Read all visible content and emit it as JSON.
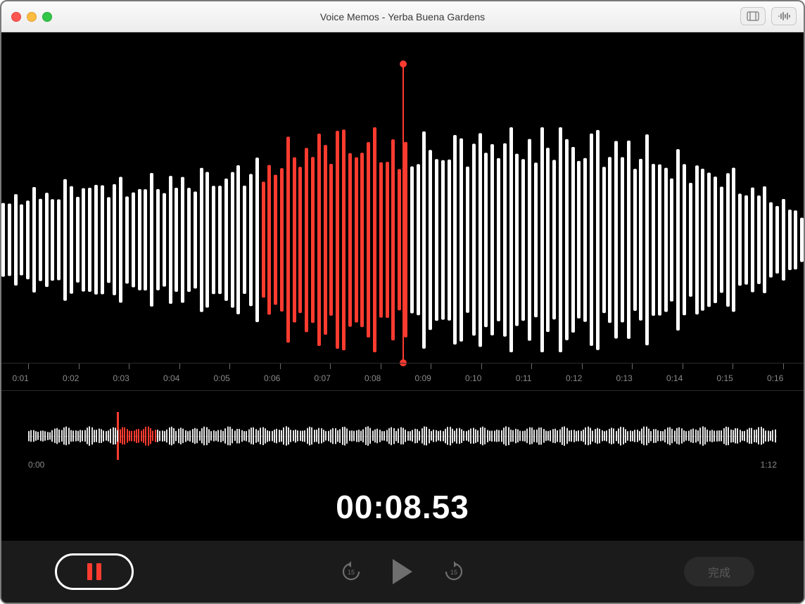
{
  "window": {
    "title": "Voice Memos - Yerba Buena Gardens"
  },
  "ruler": {
    "labels": [
      "0:01",
      "0:02",
      "0:03",
      "0:04",
      "0:05",
      "0:06",
      "0:07",
      "0:08",
      "0:09",
      "0:10",
      "0:11",
      "0:12",
      "0:13",
      "0:14",
      "0:15",
      "0:16"
    ]
  },
  "overview": {
    "start": "0:00",
    "end": "1:12",
    "playhead_fraction": 0.118
  },
  "time": {
    "current": "00:08.53"
  },
  "controls": {
    "done_label": "完成",
    "skip_seconds": "15"
  },
  "colors": {
    "accent": "#ff3b30"
  }
}
